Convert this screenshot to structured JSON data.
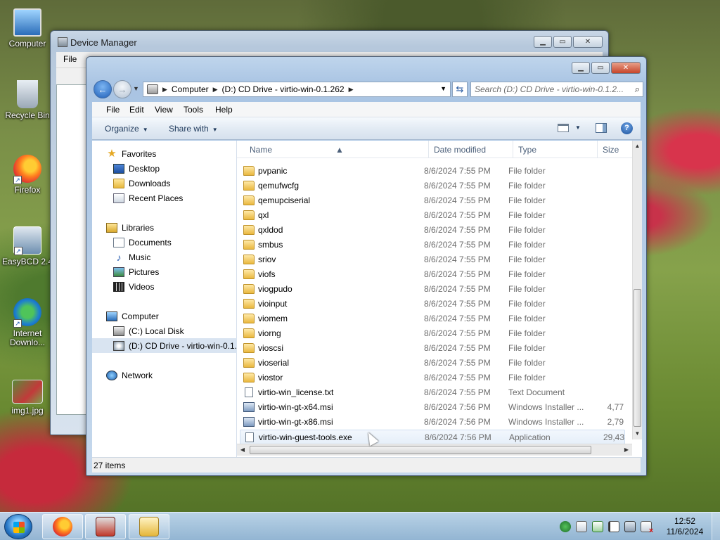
{
  "desktop": {
    "icons": [
      {
        "label": "Computer",
        "icon": "computer-icon"
      },
      {
        "label": "Recycle Bin",
        "icon": "recycle-bin-icon"
      },
      {
        "label": "Firefox",
        "icon": "firefox-icon"
      },
      {
        "label": "EasyBCD 2.4",
        "icon": "easybcd-icon"
      },
      {
        "label": "Internet Downlo...",
        "icon": "internet-download-manager-icon"
      },
      {
        "label": "img1.jpg",
        "icon": "image-file-icon"
      }
    ]
  },
  "back_window": {
    "title": "Device Manager",
    "menu_file": "File"
  },
  "explorer": {
    "address": {
      "crumbs": [
        "Computer",
        "(D:) CD Drive - virtio-win-0.1.262"
      ]
    },
    "search_placeholder": "Search (D:) CD Drive - virtio-win-0.1.2...",
    "menu": {
      "file": "File",
      "edit": "Edit",
      "view": "View",
      "tools": "Tools",
      "help": "Help"
    },
    "commands": {
      "organize": "Organize",
      "share_with": "Share with"
    },
    "nav": {
      "favorites": "Favorites",
      "desktop": "Desktop",
      "downloads": "Downloads",
      "recent_places": "Recent Places",
      "libraries": "Libraries",
      "documents": "Documents",
      "music": "Music",
      "pictures": "Pictures",
      "videos": "Videos",
      "computer": "Computer",
      "local_disk": "(C:) Local Disk",
      "cd_drive": "(D:) CD Drive - virtio-win-0.1..",
      "network": "Network"
    },
    "columns": {
      "name": "Name",
      "date": "Date modified",
      "type": "Type",
      "size": "Size"
    },
    "files": [
      {
        "name": "pvpanic",
        "date": "8/6/2024 7:55 PM",
        "type": "File folder",
        "size": "",
        "kind": "folder"
      },
      {
        "name": "qemufwcfg",
        "date": "8/6/2024 7:55 PM",
        "type": "File folder",
        "size": "",
        "kind": "folder"
      },
      {
        "name": "qemupciserial",
        "date": "8/6/2024 7:55 PM",
        "type": "File folder",
        "size": "",
        "kind": "folder"
      },
      {
        "name": "qxl",
        "date": "8/6/2024 7:55 PM",
        "type": "File folder",
        "size": "",
        "kind": "folder"
      },
      {
        "name": "qxldod",
        "date": "8/6/2024 7:55 PM",
        "type": "File folder",
        "size": "",
        "kind": "folder"
      },
      {
        "name": "smbus",
        "date": "8/6/2024 7:55 PM",
        "type": "File folder",
        "size": "",
        "kind": "folder"
      },
      {
        "name": "sriov",
        "date": "8/6/2024 7:55 PM",
        "type": "File folder",
        "size": "",
        "kind": "folder"
      },
      {
        "name": "viofs",
        "date": "8/6/2024 7:55 PM",
        "type": "File folder",
        "size": "",
        "kind": "folder"
      },
      {
        "name": "viogpudo",
        "date": "8/6/2024 7:55 PM",
        "type": "File folder",
        "size": "",
        "kind": "folder"
      },
      {
        "name": "vioinput",
        "date": "8/6/2024 7:55 PM",
        "type": "File folder",
        "size": "",
        "kind": "folder"
      },
      {
        "name": "viomem",
        "date": "8/6/2024 7:55 PM",
        "type": "File folder",
        "size": "",
        "kind": "folder"
      },
      {
        "name": "viorng",
        "date": "8/6/2024 7:55 PM",
        "type": "File folder",
        "size": "",
        "kind": "folder"
      },
      {
        "name": "vioscsi",
        "date": "8/6/2024 7:55 PM",
        "type": "File folder",
        "size": "",
        "kind": "folder"
      },
      {
        "name": "vioserial",
        "date": "8/6/2024 7:55 PM",
        "type": "File folder",
        "size": "",
        "kind": "folder"
      },
      {
        "name": "viostor",
        "date": "8/6/2024 7:55 PM",
        "type": "File folder",
        "size": "",
        "kind": "folder"
      },
      {
        "name": "virtio-win_license.txt",
        "date": "8/6/2024 7:55 PM",
        "type": "Text Document",
        "size": "",
        "kind": "txt"
      },
      {
        "name": "virtio-win-gt-x64.msi",
        "date": "8/6/2024 7:56 PM",
        "type": "Windows Installer ...",
        "size": "4,77",
        "kind": "msi"
      },
      {
        "name": "virtio-win-gt-x86.msi",
        "date": "8/6/2024 7:56 PM",
        "type": "Windows Installer ...",
        "size": "2,79",
        "kind": "msi"
      },
      {
        "name": "virtio-win-guest-tools.exe",
        "date": "8/6/2024 7:56 PM",
        "type": "Application",
        "size": "29,43",
        "kind": "exe"
      }
    ],
    "status": "27 items"
  },
  "taskbar": {
    "time": "12:52",
    "date": "11/6/2024"
  }
}
